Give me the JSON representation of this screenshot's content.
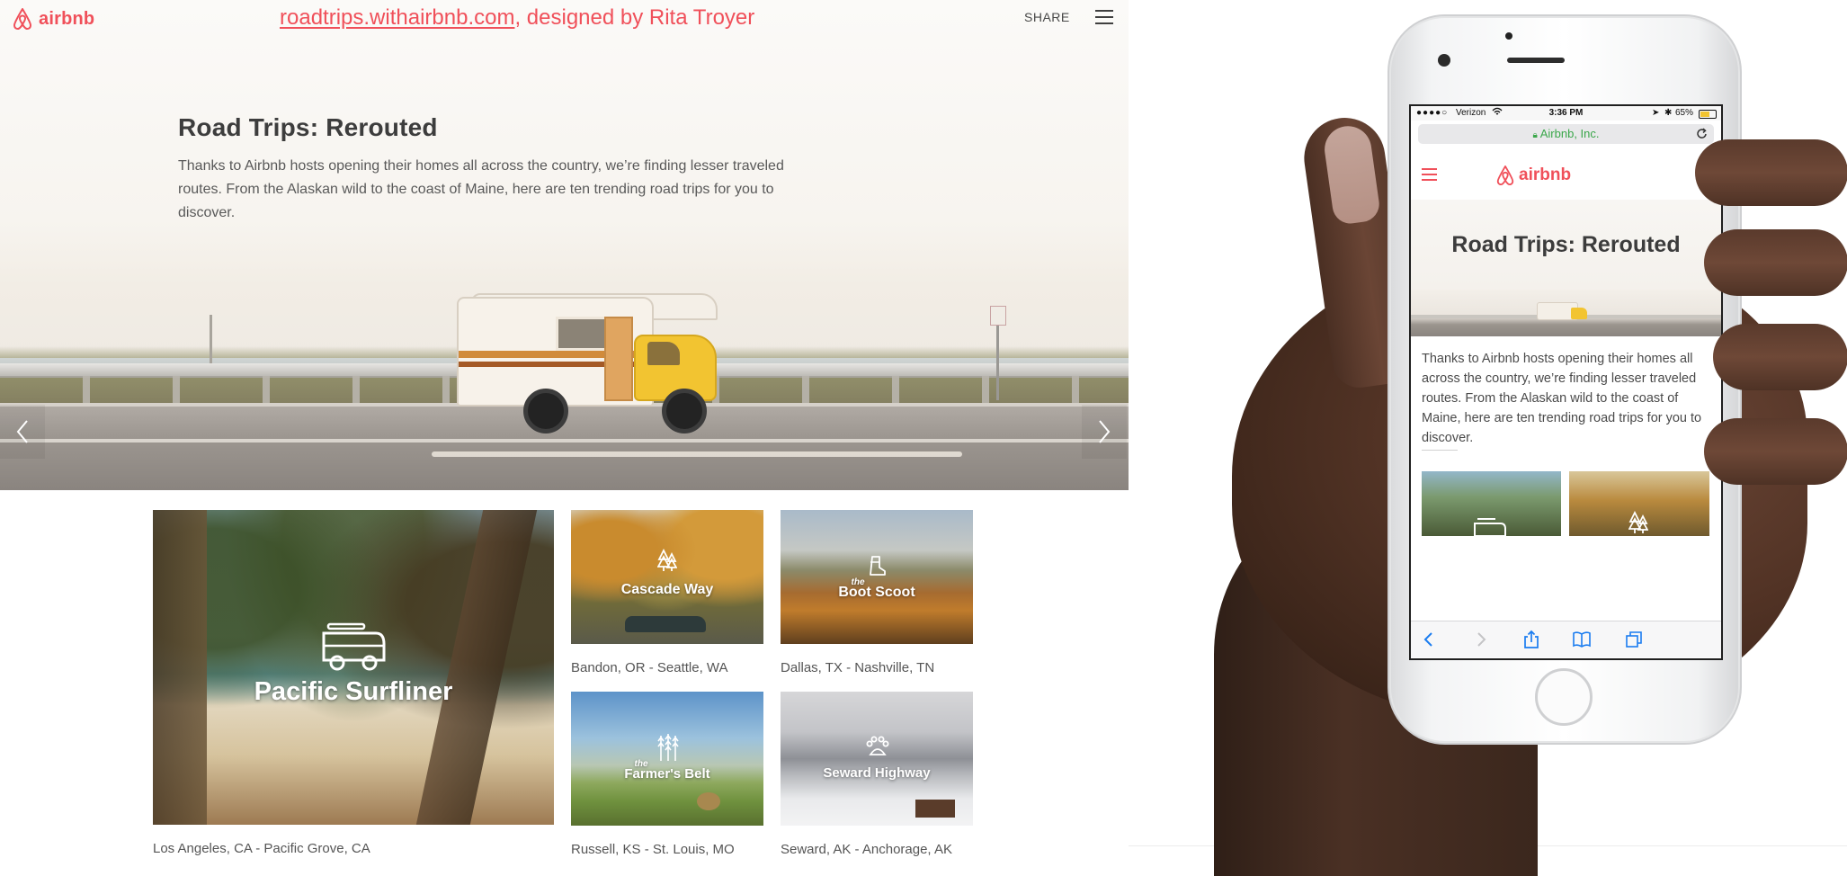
{
  "desktop": {
    "logo_text": "airbnb",
    "credit_link": "roadtrips.withairbnb.com",
    "credit_rest": ", designed by Rita Troyer",
    "share_label": "SHARE",
    "hero": {
      "title": "Road Trips: Rerouted",
      "description": "Thanks to Airbnb hosts opening their homes all across the country, we’re finding lesser traveled routes. From the Alaskan wild to the coast of Maine, here are ten trending road trips for you to discover."
    },
    "trips": [
      {
        "name": "Pacific Surfliner",
        "route": "Los Angeles, CA - Pacific Grove, CA",
        "icon": "van-icon"
      },
      {
        "name": "Cascade Way",
        "route": "Bandon, OR - Seattle, WA",
        "icon": "pine-trees-icon"
      },
      {
        "prefix": "the",
        "name": "Boot Scoot",
        "route": "Dallas, TX - Nashville, TN",
        "icon": "boot-icon"
      },
      {
        "prefix": "the",
        "name": "Farmer's Belt",
        "route": "Russell, KS - St. Louis, MO",
        "icon": "wheat-icon"
      },
      {
        "name": "Seward Highway",
        "route": "Seward, AK - Anchorage, AK",
        "icon": "paw-icon"
      }
    ]
  },
  "phone": {
    "status": {
      "carrier": "Verizon",
      "time": "3:36 PM",
      "battery": "65%"
    },
    "address": "Airbnb, Inc.",
    "logo_text": "airbnb",
    "title": "Road Trips: Rerouted",
    "description": "Thanks to Airbnb hosts opening their homes all across the country, we’re finding lesser traveled routes. From the Alaskan wild to the coast of Maine, here are ten trending road trips for you to discover."
  },
  "colors": {
    "brand": "#f0505a",
    "text": "#484848",
    "link_green": "#3aa74a"
  }
}
